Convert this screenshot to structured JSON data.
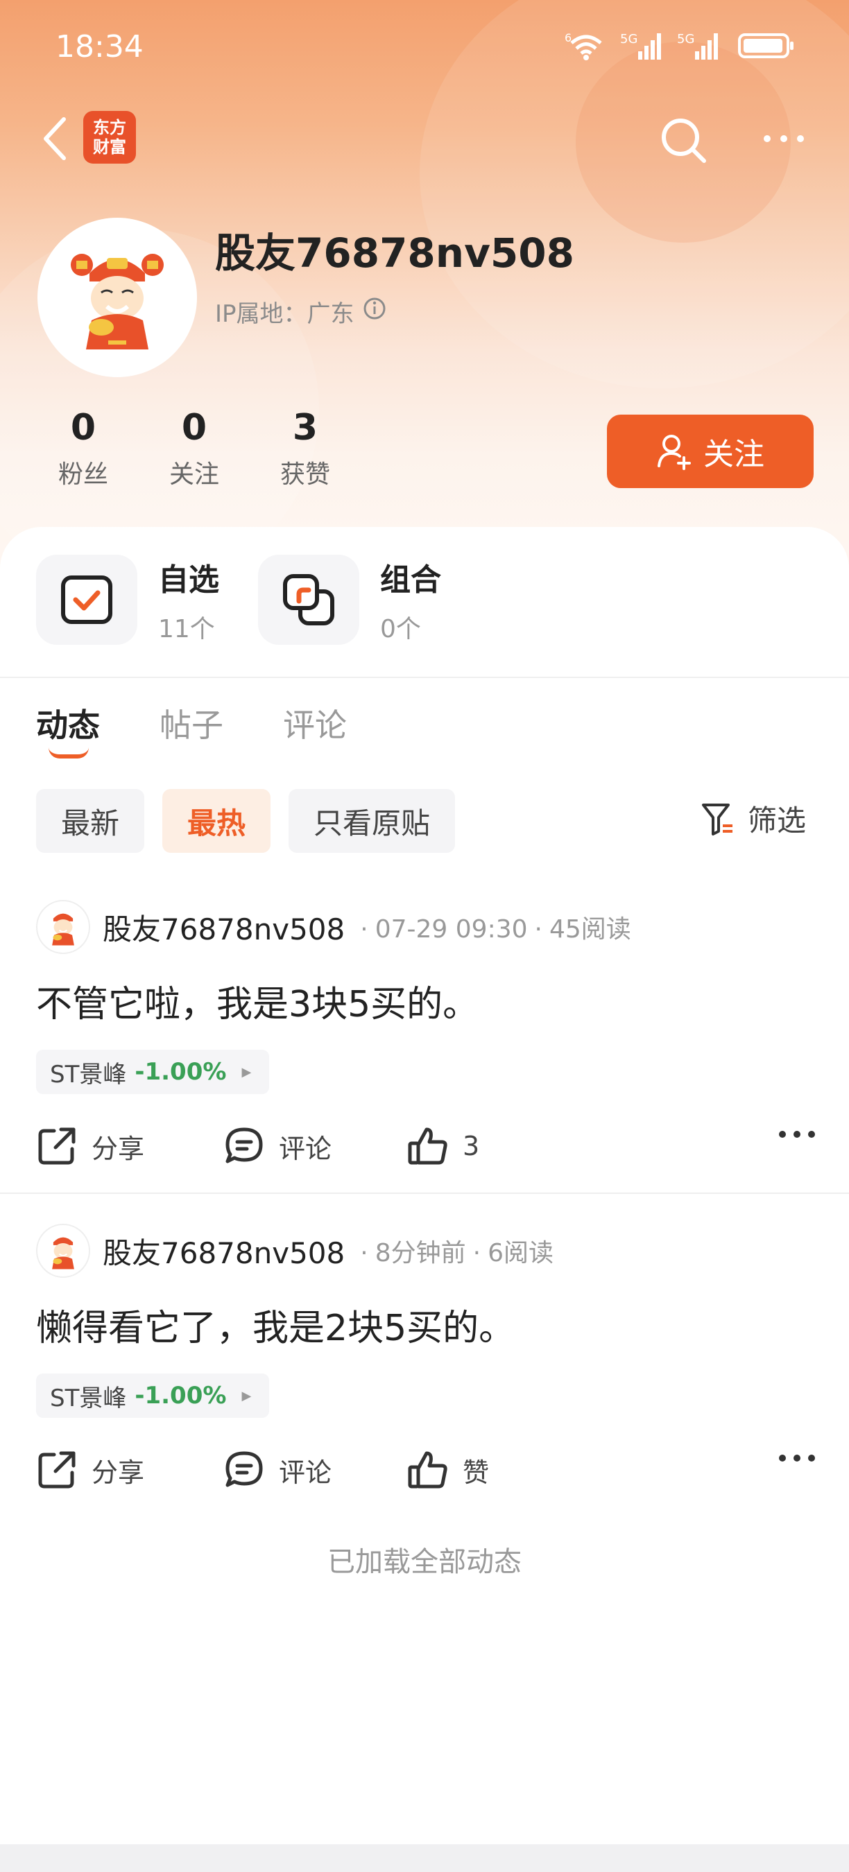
{
  "status_bar": {
    "time": "18:34",
    "network_1": "5G",
    "network_2": "5G",
    "wifi_label": "6"
  },
  "nav": {
    "logo_line1": "东方",
    "logo_line2": "财富"
  },
  "profile": {
    "username": "股友76878nv508",
    "ip_label": "IP属地：广东",
    "stats": [
      {
        "value": "0",
        "label": "粉丝"
      },
      {
        "value": "0",
        "label": "关注"
      },
      {
        "value": "3",
        "label": "获赞"
      }
    ],
    "follow_label": "关注"
  },
  "quick": [
    {
      "title": "自选",
      "count": "11个"
    },
    {
      "title": "组合",
      "count": "0个"
    }
  ],
  "tabs": [
    {
      "label": "动态",
      "active": true
    },
    {
      "label": "帖子",
      "active": false
    },
    {
      "label": "评论",
      "active": false
    }
  ],
  "chips": [
    {
      "label": "最新",
      "active": false
    },
    {
      "label": "最热",
      "active": true
    },
    {
      "label": "只看原贴",
      "active": false
    }
  ],
  "filter_label": "筛选",
  "posts": [
    {
      "author": "股友76878nv508",
      "time": "07-29 09:30",
      "reads": "45阅读",
      "text": "不管它啦，我是3块5买的。",
      "stock_name": "ST景峰",
      "stock_change": "-1.00%",
      "share_label": "分享",
      "comment_label": "评论",
      "like_label": "3"
    },
    {
      "author": "股友76878nv508",
      "time": "8分钟前",
      "reads": "6阅读",
      "text": "懒得看它了，我是2块5买的。",
      "stock_name": "ST景峰",
      "stock_change": "-1.00%",
      "share_label": "分享",
      "comment_label": "评论",
      "like_label": "赞"
    }
  ],
  "loaded_all": "已加载全部动态",
  "colors": {
    "accent": "#ee5e27",
    "stock_down": "#3aa056"
  }
}
